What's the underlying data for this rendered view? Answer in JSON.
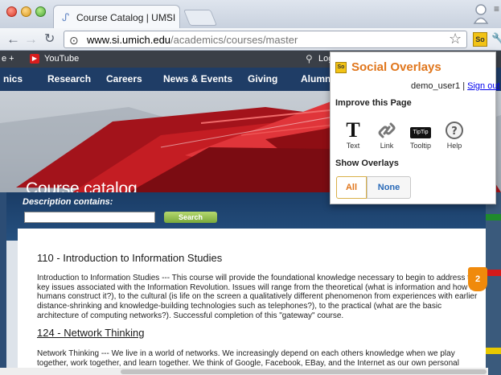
{
  "browser": {
    "tab_title": "Course Catalog | UMSI",
    "tab_close": "×",
    "url_domain": "www.si.umich.edu",
    "url_path": "/academics/courses/master",
    "ext_badge": "So"
  },
  "bookmarks": {
    "item_partial": "e +",
    "youtube": "YouTube",
    "log_partial": "Log"
  },
  "site_nav": [
    "nics",
    "Research",
    "Careers",
    "News & Events",
    "Giving",
    "Alumn"
  ],
  "hero": {
    "title": "Course catalog"
  },
  "search": {
    "label": "Description contains:",
    "button": "Search"
  },
  "courses": [
    {
      "title": "110 - Introduction to Information Studies",
      "desc": "Introduction to Information Studies --- This course will provide the foundational knowledge necessary to begin to address the key issues associated with the Information Revolution. Issues will range from the theoretical (what is information and how do humans construct it?), to the cultural (is life on the screen a qualitatively different phenomenon from experiences with earlier distance-shrinking and knowledge-building technologies such as telephones?), to the practical (what are the basic architecture of computing networks?). Successful completion of this \"gateway\" course."
    },
    {
      "title": "124 - Network Thinking",
      "desc": "Network Thinking --- We live in a world of networks. We increasingly depend on each others knowledge when we play together, work together, and learn together. We think of Google, Facebook, EBay, and the Internet as our own personal"
    }
  ],
  "popup": {
    "logo": "So",
    "title": "Social Overlays",
    "user": "demo_user1",
    "separator": " | ",
    "sign_out": "Sign out",
    "improve_heading": "Improve this Page",
    "tools": [
      {
        "icon": "T",
        "label": "Text"
      },
      {
        "icon": "link-icon",
        "label": "Link"
      },
      {
        "icon": "TipTip",
        "label": "Tooltip"
      },
      {
        "icon": "help-icon",
        "label": "Help"
      }
    ],
    "show_heading": "Show Overlays",
    "btn_all": "All",
    "btn_none": "None"
  },
  "overlay_count": "2",
  "colors": {
    "accent_orange": "#e0761c",
    "site_navy": "#1f3d66",
    "marker_green": "#1f8a2c",
    "marker_red": "#d41a1a",
    "marker_yellow": "#e8c800"
  }
}
